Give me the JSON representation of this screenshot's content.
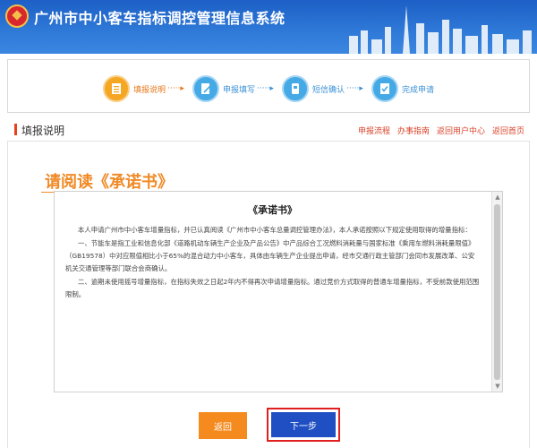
{
  "header": {
    "title": "广州市中小客车指标调控管理信息系统"
  },
  "steps": [
    {
      "label": "填报说明",
      "state": "active",
      "icon": "document-list-icon"
    },
    {
      "label": "申报填写",
      "state": "todo",
      "icon": "edit-form-icon"
    },
    {
      "label": "短信确认",
      "state": "todo",
      "icon": "phone-sms-icon"
    },
    {
      "label": "完成申请",
      "state": "todo",
      "icon": "complete-check-icon"
    }
  ],
  "section": {
    "title": "填报说明",
    "links": [
      "申报流程",
      "办事指南",
      "返回用户中心",
      "返回首页"
    ]
  },
  "main": {
    "heading": "请阅读《承诺书》",
    "doc_title": "《承诺书》",
    "paragraphs": [
      "本人申请广州市中小客车增量指标，并已认真阅读《广州市中小客车总量调控管理办法》，本人承诺按照以下规定使用取得的增量指标：",
      "一、节能车是指工业和信息化部《道路机动车辆生产企业及产品公告》中产品综合工况燃料消耗量与国家标准《乘用车燃料消耗量限值》（GB19578）中对应限值相比小于65%的混合动力中小客车，具体由车辆生产企业提出申请，经市交通行政主管部门会同市发展改革、公安机关交通管理等部门联合会商确认。",
      "二、逾期未使用摇号增量指标，在指标失效之日起2年内不得再次申请增量指标。通过竞价方式取得的普通车增量指标，不受前款使用范围限制。"
    ]
  },
  "buttons": {
    "back": "返回",
    "next": "下一步"
  },
  "colors": {
    "header_blue": "#2f7ad8",
    "accent_orange": "#f08a26",
    "link_red": "#d9432a",
    "next_blue": "#1f4fc2"
  }
}
